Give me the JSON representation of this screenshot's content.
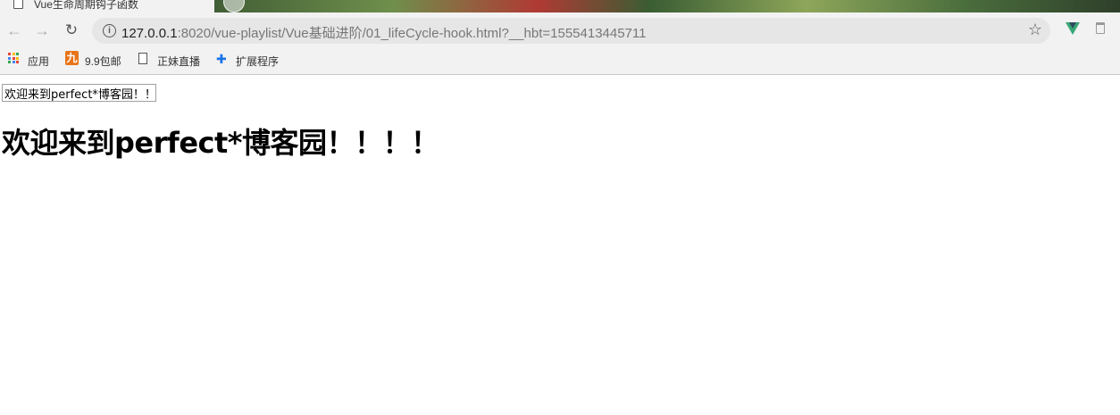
{
  "tab": {
    "title": "Vue生命周期钩子函数",
    "icon": "document-icon"
  },
  "toolbar": {
    "back_icon": "←",
    "forward_icon": "→",
    "reload_icon": "↻",
    "url_host": "127.0.0.1",
    "url_rest": ":8020/vue-playlist/Vue基础进阶/01_lifeCycle-hook.html?__hbt=1555413445711",
    "star_icon": "☆",
    "info_icon": "i"
  },
  "bookmarks": {
    "items": [
      {
        "label": "应用",
        "icon": "apps-grid-icon"
      },
      {
        "label": "9.9包邮",
        "icon": "jiu-icon",
        "icon_text": "九"
      },
      {
        "label": "正妹直播",
        "icon": "document-icon"
      },
      {
        "label": "扩展程序",
        "icon": "puzzle-icon"
      }
    ]
  },
  "page": {
    "input_value": "欢迎来到perfect*博客园！！",
    "heading": "欢迎来到perfect*博客园！！！！"
  },
  "colors": {
    "chrome_bg": "#f2f2f2",
    "vue_green": "#3aa776",
    "jiu_orange": "#e8751a",
    "puzzle_blue": "#1a73e8"
  }
}
